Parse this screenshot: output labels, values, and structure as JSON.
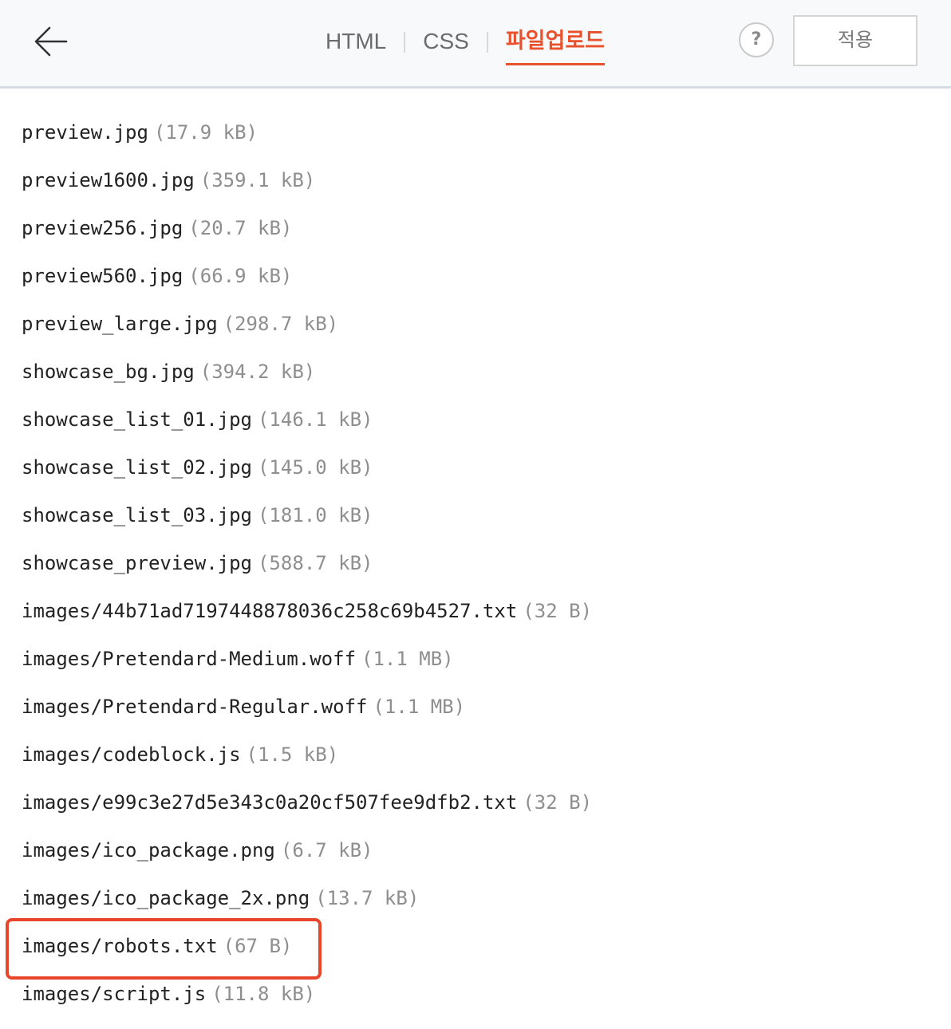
{
  "header": {
    "back_icon": "arrow-left-icon",
    "tabs": [
      {
        "label": "HTML",
        "active": false
      },
      {
        "label": "CSS",
        "active": false
      },
      {
        "label": "파일업로드",
        "active": true
      }
    ],
    "help_label": "?",
    "apply_label": "적용",
    "accent_color": "#e8512c"
  },
  "files": [
    {
      "name": "preview.jpg",
      "size": "(17.9 kB)"
    },
    {
      "name": "preview1600.jpg",
      "size": "(359.1 kB)"
    },
    {
      "name": "preview256.jpg",
      "size": "(20.7 kB)"
    },
    {
      "name": "preview560.jpg",
      "size": "(66.9 kB)"
    },
    {
      "name": "preview_large.jpg",
      "size": "(298.7 kB)"
    },
    {
      "name": "showcase_bg.jpg",
      "size": "(394.2 kB)"
    },
    {
      "name": "showcase_list_01.jpg",
      "size": "(146.1 kB)"
    },
    {
      "name": "showcase_list_02.jpg",
      "size": "(145.0 kB)"
    },
    {
      "name": "showcase_list_03.jpg",
      "size": "(181.0 kB)"
    },
    {
      "name": "showcase_preview.jpg",
      "size": "(588.7 kB)"
    },
    {
      "name": "images/44b71ad7197448878036c258c69b4527.txt",
      "size": "(32 B)"
    },
    {
      "name": "images/Pretendard-Medium.woff",
      "size": "(1.1 MB)"
    },
    {
      "name": "images/Pretendard-Regular.woff",
      "size": "(1.1 MB)"
    },
    {
      "name": "images/codeblock.js",
      "size": "(1.5 kB)"
    },
    {
      "name": "images/e99c3e27d5e343c0a20cf507fee9dfb2.txt",
      "size": "(32 B)"
    },
    {
      "name": "images/ico_package.png",
      "size": "(6.7 kB)"
    },
    {
      "name": "images/ico_package_2x.png",
      "size": "(13.7 kB)"
    },
    {
      "name": "images/robots.txt",
      "size": "(67 B)",
      "highlighted": true
    },
    {
      "name": "images/script.js",
      "size": "(11.8 kB)"
    }
  ],
  "highlight_color": "#e8452b"
}
